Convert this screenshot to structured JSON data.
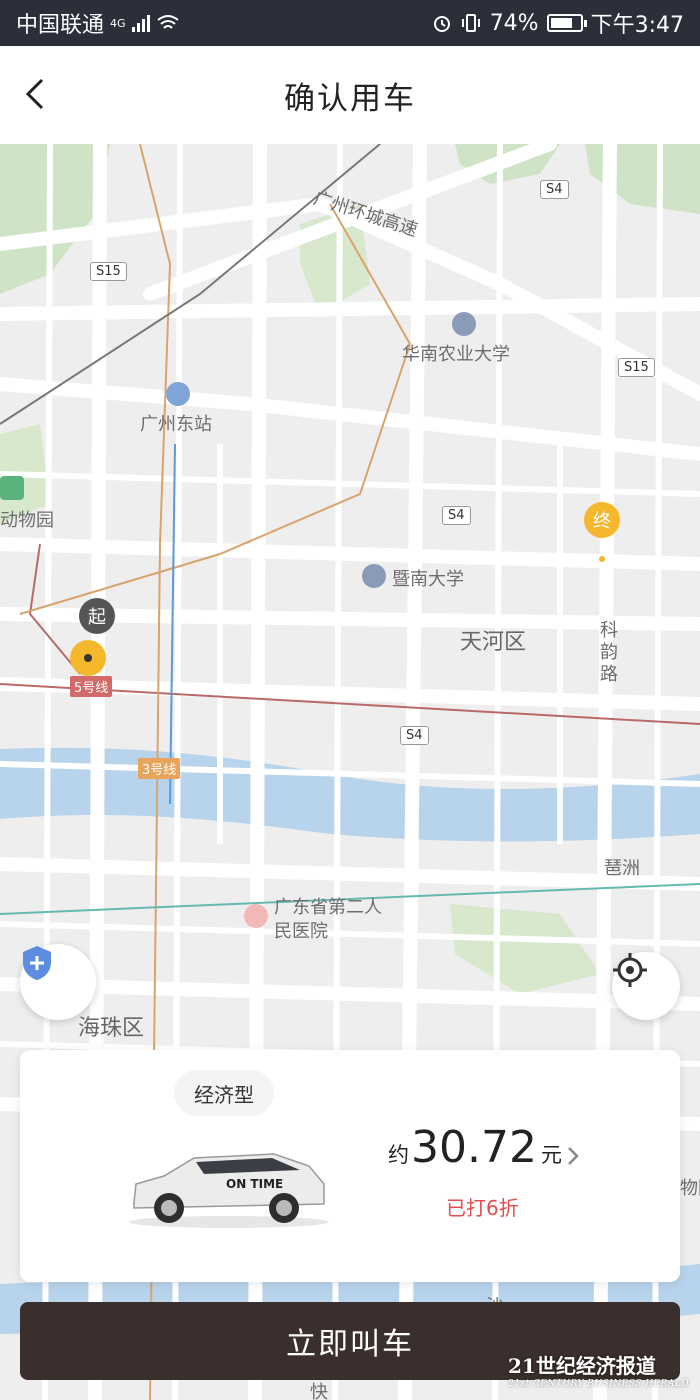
{
  "status_bar": {
    "carrier": "中国联通",
    "network": "4G",
    "battery_percent": "74%",
    "battery_level": 0.74,
    "time": "下午3:47",
    "bg_color": "#2b2f3a"
  },
  "header": {
    "title": "确认用车",
    "back_icon": "chevron-left-icon"
  },
  "map": {
    "labels": {
      "ring_highway": "广州环城高速",
      "scau": "华南农业大学",
      "guangzhou_east": "广州东站",
      "zoo": "动物园",
      "jinan_univ": "暨南大学",
      "tianhe": "天河区",
      "kejun_road": "科韵路",
      "pazhou": "琶洲",
      "hospital": "广东省第二人民医院",
      "haizhu": "海珠区",
      "right_edge": "物园",
      "sha": "沙",
      "kuai": "快"
    },
    "shields": {
      "s4_top": "S4",
      "s15_left": "S15",
      "s15_right": "S15",
      "s4_mid": "S4",
      "s4_low": "S4"
    },
    "metro": {
      "line5": "5号线",
      "line3": "3号线"
    },
    "pins": {
      "start": "起",
      "end": "终"
    }
  },
  "buttons": {
    "safety_icon": "shield-plus-icon",
    "locate_icon": "crosshair-locate-icon"
  },
  "ride_card": {
    "car_type": "经济型",
    "car_brand": "ON TIME",
    "price_prefix": "约",
    "price": "30.72",
    "price_unit": "元",
    "discount": "已打6折",
    "discount_color": "#e24d4d"
  },
  "cta": {
    "label": "立即叫车",
    "color": "#3a2f2c"
  },
  "watermark": {
    "line1": "21世纪经济报道",
    "line2": "21st CENTURY BUSINESS HERALD"
  }
}
